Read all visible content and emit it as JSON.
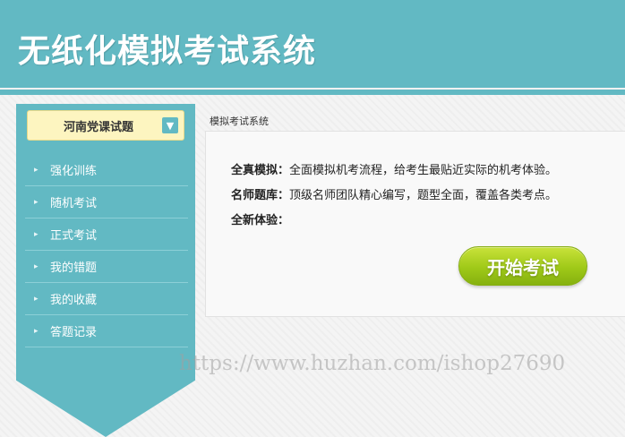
{
  "header": {
    "title": "无纸化模拟考试系统"
  },
  "sidebar": {
    "select_label": "河南党课试题",
    "select_icon": "chevron-down-icon",
    "items": [
      {
        "label": "强化训练"
      },
      {
        "label": "随机考试"
      },
      {
        "label": "正式考试"
      },
      {
        "label": "我的错题"
      },
      {
        "label": "我的收藏"
      },
      {
        "label": "答题记录"
      }
    ]
  },
  "main": {
    "breadcrumb": "模拟考试系统",
    "lines": [
      {
        "label": "全真模拟：",
        "text": "全面模拟机考流程，给考生最贴近实际的机考体验。"
      },
      {
        "label": "名师题库：",
        "text": "顶级名师团队精心编写，题型全面，覆盖各类考点。"
      },
      {
        "label": "全新体验：",
        "text": ""
      }
    ],
    "start_button": "开始考试"
  },
  "watermark": "https://www.huzhan.com/ishop27690",
  "colors": {
    "primary": "#62b9c3",
    "button": "#9fc918",
    "select_bg": "#fdf5c0"
  }
}
